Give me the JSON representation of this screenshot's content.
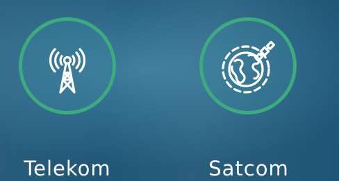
{
  "colors": {
    "ring": "#3cab7d",
    "icon_stroke": "#ffffff",
    "background": "#2f6c8d"
  },
  "services": [
    {
      "label": "Telekom",
      "icon": "antenna-tower-icon"
    },
    {
      "label": "Satcom",
      "icon": "globe-satellite-icon"
    }
  ]
}
